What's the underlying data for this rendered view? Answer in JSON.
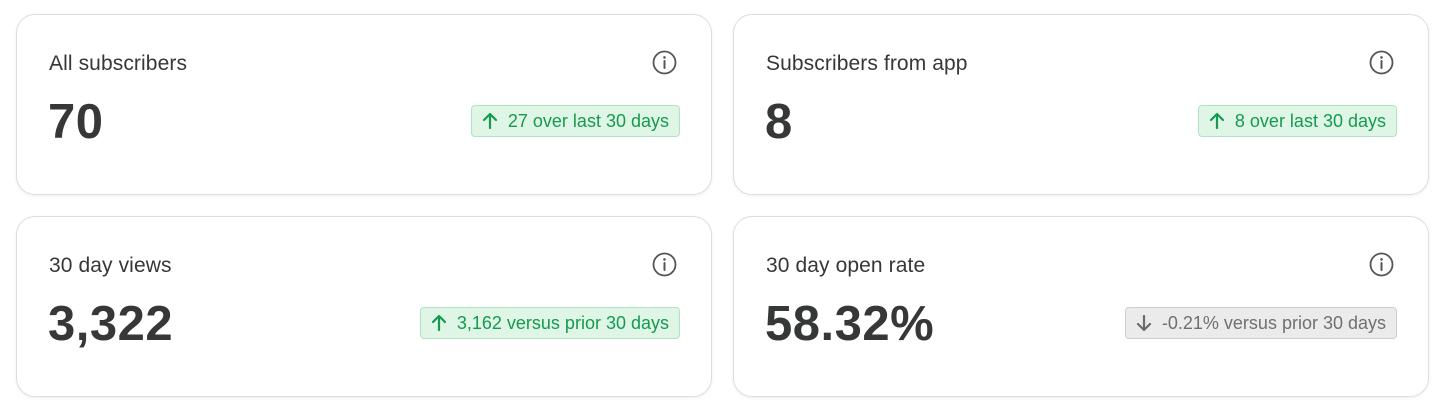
{
  "colors": {
    "positive_text": "#169a4f",
    "positive_bg": "#dff6e6",
    "neutral_text": "#707070",
    "neutral_bg": "#ebebeb",
    "value_text": "#363737"
  },
  "cards": [
    {
      "title": "All subscribers",
      "value": "70",
      "info_icon": "info-circle-icon",
      "change": {
        "direction": "up",
        "icon": "arrow-up-icon",
        "text": "27 over last 30 days"
      }
    },
    {
      "title": "Subscribers from app",
      "value": "8",
      "info_icon": "info-circle-icon",
      "change": {
        "direction": "up",
        "icon": "arrow-up-icon",
        "text": "8 over last 30 days"
      }
    },
    {
      "title": "30 day views",
      "value": "3,322",
      "info_icon": "info-circle-icon",
      "change": {
        "direction": "up",
        "icon": "arrow-up-icon",
        "text": "3,162 versus prior 30 days"
      }
    },
    {
      "title": "30 day open rate",
      "value": "58.32%",
      "info_icon": "info-circle-icon",
      "change": {
        "direction": "down",
        "icon": "arrow-down-icon",
        "text": "-0.21% versus prior 30 days"
      }
    }
  ]
}
